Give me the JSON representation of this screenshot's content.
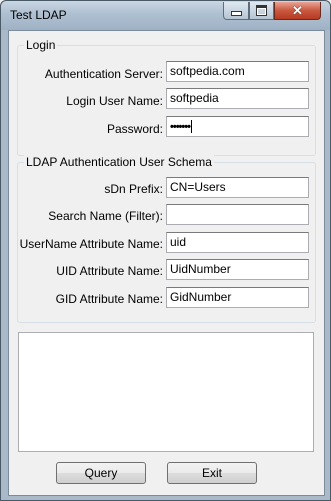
{
  "window": {
    "title": "Test LDAP",
    "close_glyph": "✕"
  },
  "login": {
    "legend": "Login",
    "server_label": "Authentication Server:",
    "server_value": "softpedia.com",
    "username_label": "Login User Name:",
    "username_value": "softpedia",
    "password_label": "Password:",
    "password_mask": "•••••••"
  },
  "schema": {
    "legend": "LDAP Authentication User Schema",
    "sdn_label": "sDn Prefix:",
    "sdn_value": "CN=Users",
    "search_label": "Search Name (Filter):",
    "search_value": "",
    "username_attr_label": "UserName Attribute Name:",
    "username_attr_value": "uid",
    "uid_attr_label": "UID Attribute Name:",
    "uid_attr_value": "UidNumber",
    "gid_attr_label": "GID Attribute Name:",
    "gid_attr_value": "GidNumber"
  },
  "output": {
    "text": ""
  },
  "buttons": {
    "query": "Query",
    "exit": "Exit"
  }
}
